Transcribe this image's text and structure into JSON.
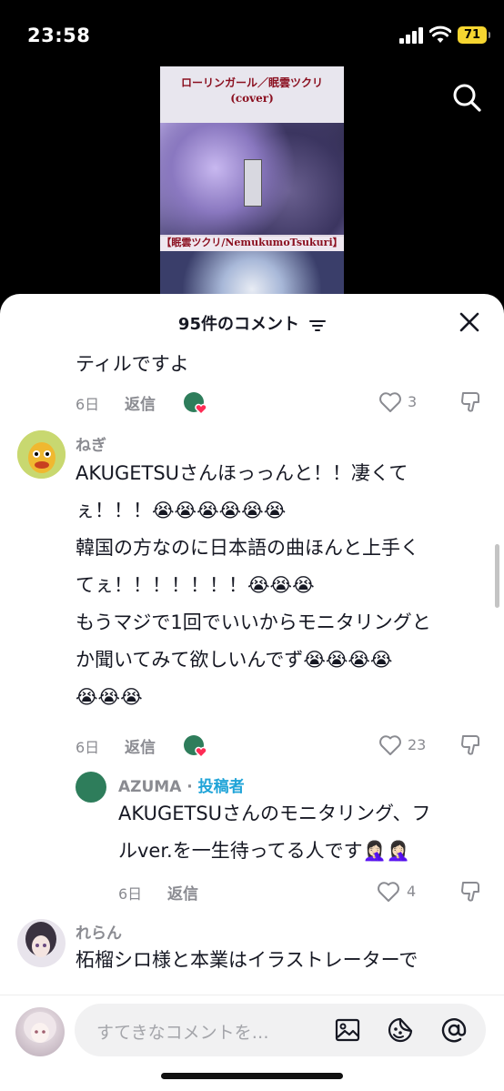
{
  "status_bar": {
    "time": "23:58",
    "battery": "71"
  },
  "video": {
    "title_line1": "ローリンガール／眠雲ツクリ",
    "title_line2": "(cover)",
    "subtitle": "【眠雲ツクリ/NemukumoTsukuri】"
  },
  "sheet": {
    "title": "95件のコメント"
  },
  "comments": [
    {
      "text_lines": [
        "ティルですよ"
      ],
      "age": "6日",
      "reply_label": "返信",
      "likes": "3"
    },
    {
      "name": "ねぎ",
      "text_lines": [
        "AKUGETSUさんほっっんと！！凄くて",
        "ぇ！！！😭😭😭😭😭😭",
        "韓国の方なのに日本語の曲ほんと上手く",
        "てぇ！！！！！！！😭😭😭",
        "もうマジで1回でいいからモニタリングと",
        "か聞いてみて欲しいんでず😭😭😭😭",
        "😭😭😭"
      ],
      "age": "6日",
      "reply_label": "返信",
      "likes": "23"
    },
    {
      "name": "AZUMA",
      "separator": " · ",
      "author_tag": "投稿者",
      "text_lines": [
        "AKUGETSUさんのモニタリング、フ",
        "ルver.を一生待ってる人です🤦🏻‍♀️🤦🏻‍♀️"
      ],
      "age": "6日",
      "reply_label": "返信",
      "likes": "4"
    },
    {
      "name": "れらん",
      "text_lines": [
        "柘榴シロ様と本業はイラストレーターで"
      ]
    }
  ],
  "input": {
    "placeholder": "すてきなコメントを…"
  },
  "colors": {
    "author_tag": "#20a4d8",
    "heart_red": "#fe2c55",
    "creator_green": "#2e7d5b"
  }
}
